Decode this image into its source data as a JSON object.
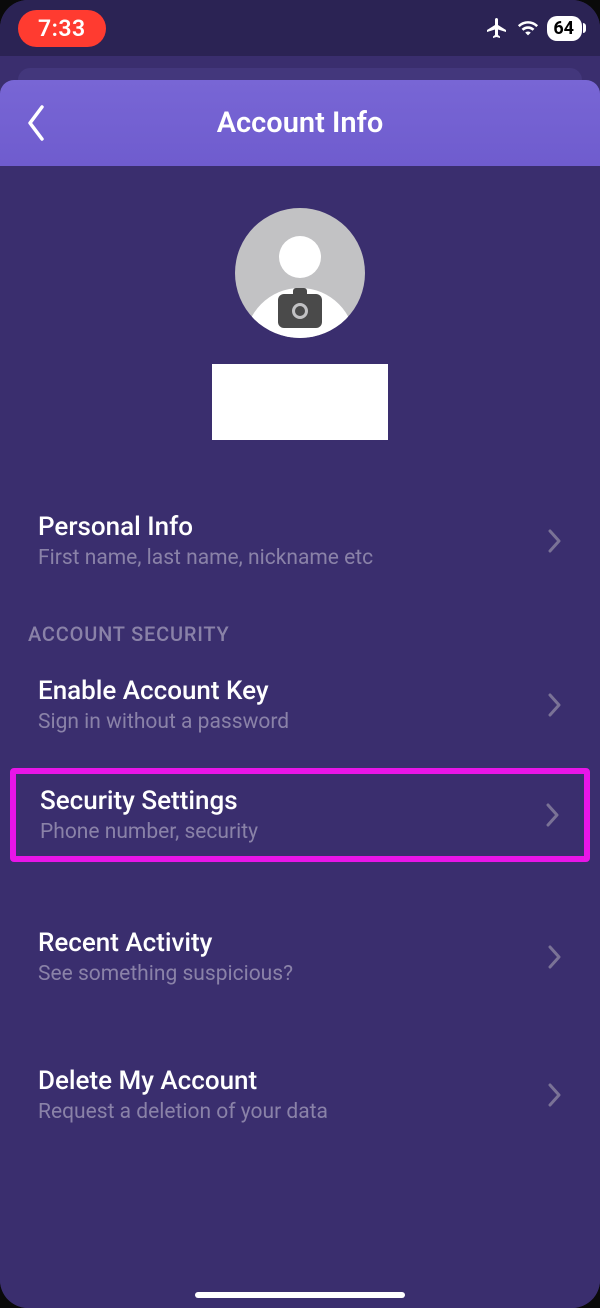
{
  "statusBar": {
    "time": "7:33",
    "battery": "64"
  },
  "header": {
    "title": "Account Info"
  },
  "sections": {
    "personalInfo": {
      "title": "Personal Info",
      "subtitle": "First name, last name, nickname etc"
    },
    "securityLabel": "ACCOUNT SECURITY",
    "enableAccountKey": {
      "title": "Enable Account Key",
      "subtitle": "Sign in without a password"
    },
    "securitySettings": {
      "title": "Security Settings",
      "subtitle": "Phone number, security"
    },
    "recentActivity": {
      "title": "Recent Activity",
      "subtitle": "See something suspicious?"
    },
    "deleteAccount": {
      "title": "Delete My Account",
      "subtitle": "Request a deletion of your data"
    }
  }
}
